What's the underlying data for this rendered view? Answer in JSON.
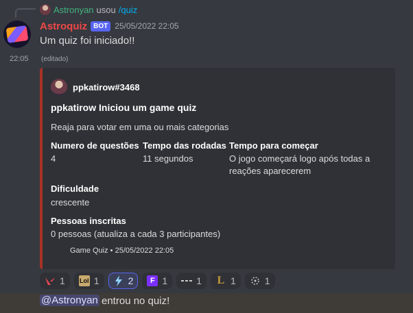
{
  "reply": {
    "user": "Astronyan",
    "text": "usou",
    "command": "/quiz"
  },
  "message": {
    "author": "Astroquiz",
    "bot_tag": "BOT",
    "timestamp": "25/05/2022 22:05",
    "text": "Um quiz foi iniciado!!",
    "side_time": "22:05",
    "edited": "(editado)"
  },
  "embed": {
    "border_color": "#a93226",
    "author": "ppkatirow#3468",
    "title": "ppkatirow Iniciou um game quiz",
    "description": "Reaja para votar em uma ou mais categorias",
    "fields": [
      {
        "name": "Numero de questões",
        "value": "4"
      },
      {
        "name": "Tempo das rodadas",
        "value": "11 segundos"
      },
      {
        "name": "Tempo para começar",
        "value": "O jogo começará logo após todas a reações aparecerem"
      },
      {
        "name": "Dificuldade",
        "value": "crescente"
      },
      {
        "name": "Pessoas inscritas",
        "value": "0 pessoas (atualiza a cada 3 participantes)"
      }
    ],
    "footer": "Game Quiz • 25/05/2022 22:05"
  },
  "reactions": [
    {
      "icon": "valorant-icon",
      "count": "1"
    },
    {
      "icon": "lol-icon",
      "count": "1"
    },
    {
      "icon": "bolt-icon",
      "count": "2",
      "active": true
    },
    {
      "icon": "f-icon",
      "count": "1"
    },
    {
      "icon": "dash-icon",
      "count": "1"
    },
    {
      "icon": "l-icon",
      "count": "1"
    },
    {
      "icon": "target-icon",
      "count": "1"
    }
  ],
  "join": {
    "mention": "@Astronyan",
    "text": "entrou no quiz!"
  }
}
